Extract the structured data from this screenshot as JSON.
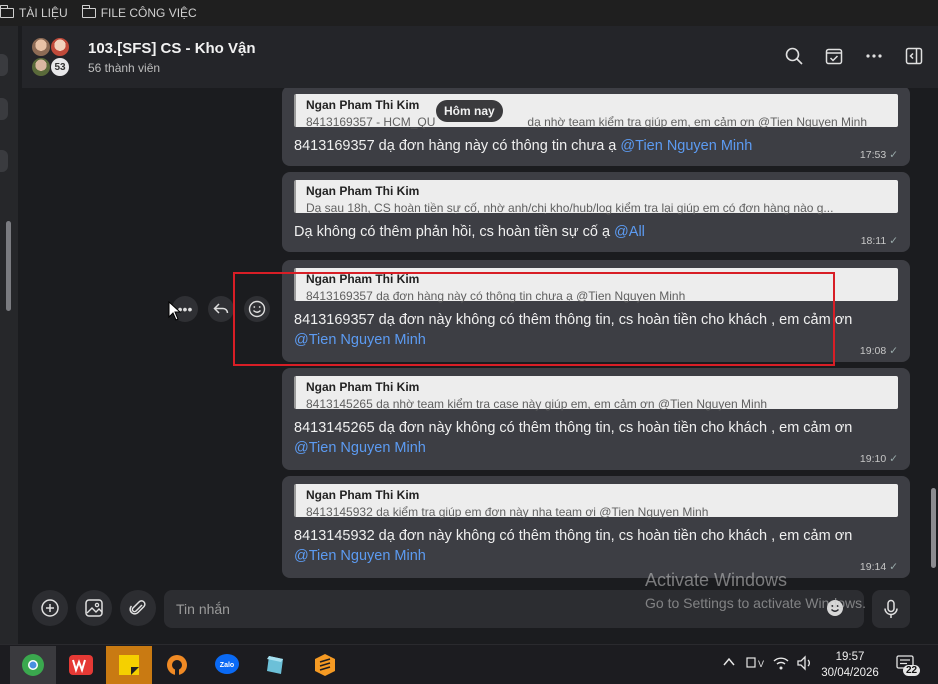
{
  "bookmarks": [
    {
      "label": "TÀI LIỆU"
    },
    {
      "label": "FILE CÔNG VIỆC"
    }
  ],
  "header": {
    "group_name": "103.[SFS] CS - Kho Vận",
    "member_count": "56 thành viên",
    "avatar_count": "53"
  },
  "chat": {
    "date_chip": "Hôm nay",
    "messages": [
      {
        "quote_name": "Ngan Pham Thi Kim",
        "quote_text": "8413169357 - HCM_QU",
        "quote_text_tail": "dạ nhờ team kiểm tra giúp em, em cảm ơn @Tien Nguyen Minh",
        "text": "8413169357 dạ đơn hàng này có thông tin chưa ạ ",
        "mention": "@Tien Nguyen Minh",
        "time": "17:53"
      },
      {
        "quote_name": "Ngan Pham Thi Kim",
        "quote_text": "Dạ sau 18h, CS hoàn tiền sự cố, nhờ anh/chị kho/hub/log kiểm tra lại giúp em có đơn hàng nào g...",
        "text": "Dạ không có thêm phản hồi, cs hoàn tiền sự cố ạ ",
        "mention": "@All",
        "time": "18:11"
      },
      {
        "quote_name": "Ngan Pham Thi Kim",
        "quote_text": "8413169357 dạ đơn hàng này có thông tin chưa ạ @Tien Nguyen Minh",
        "text": "8413169357 dạ đơn này không có thêm thông tin, cs hoàn tiền cho khách , em cảm ơn",
        "mention": "@Tien Nguyen Minh",
        "time": "19:08"
      },
      {
        "quote_name": "Ngan Pham Thi Kim",
        "quote_text": "8413145265 dạ nhờ team kiểm tra case này giúp em, em cảm ơn @Tien Nguyen Minh",
        "text": "8413145265  dạ đơn này không có thêm thông tin, cs hoàn tiền cho khách , em cảm ơn",
        "mention": "@Tien Nguyen Minh",
        "time": "19:10"
      },
      {
        "quote_name": "Ngan Pham Thi Kim",
        "quote_text": "8413145932 dạ kiểm tra giúp em đơn này nha team ơi @Tien Nguyen Minh",
        "text": "8413145932 dạ đơn này không có thêm thông tin, cs hoàn tiền cho khách , em cảm ơn",
        "mention": "@Tien Nguyen Minh",
        "time": "19:14"
      }
    ]
  },
  "composer": {
    "placeholder": "Tin nhắn"
  },
  "watermark": {
    "line1": "Activate Windows",
    "line2": "Go to Settings to activate Windows."
  },
  "taskbar": {
    "time": "19:57",
    "date": "30/04/2026",
    "notification_count": "22"
  },
  "colors": {
    "mention": "#5c9bf2",
    "highlight_box": "#d81e26",
    "bubble": "#3d3e44"
  }
}
